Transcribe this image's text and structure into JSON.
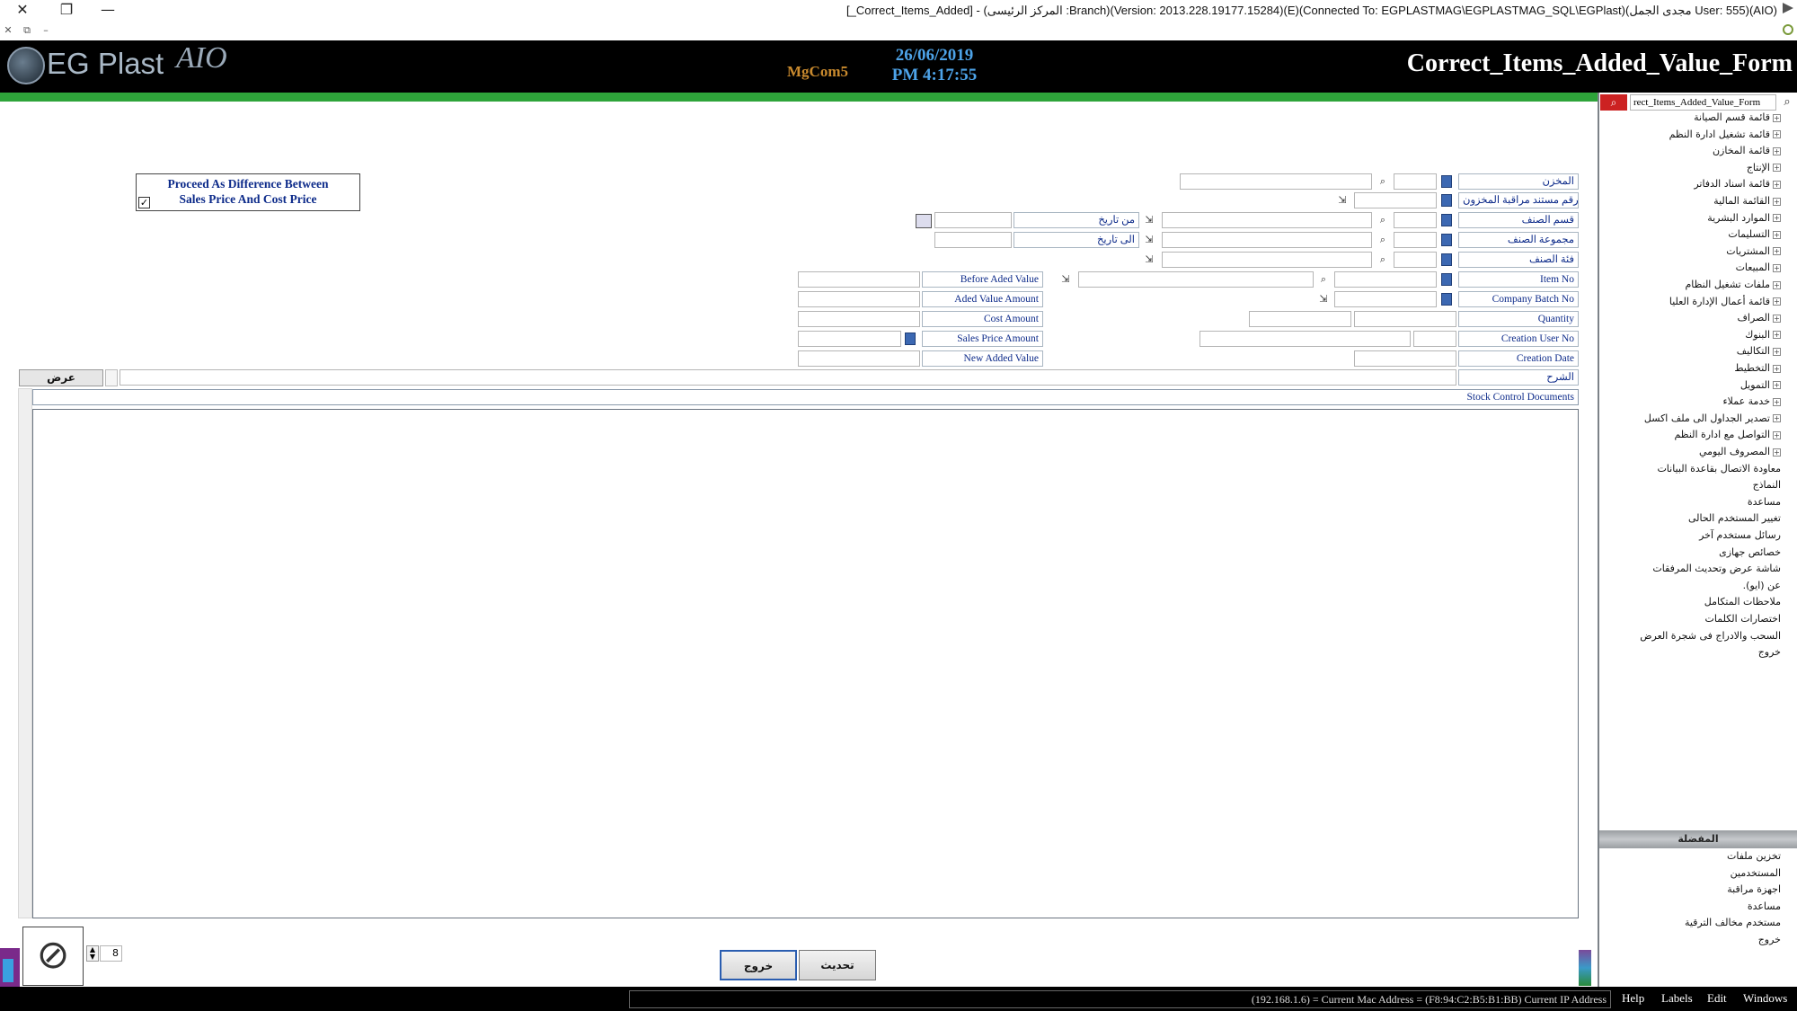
{
  "window": {
    "title": "[_Correct_Items_Added] - (المركز الرئيسى :Branch)(Version: 2013.228.19177.15284)(E)(Connected To: EGPLASTMAG\\EGPLASTMAG_SQL\\EGPlast)(مجدى الجمل User: 555)(AIO)",
    "close_glyph": "✕",
    "restore_glyph": "❐",
    "minimize_glyph": "—",
    "sub_close": "✕",
    "sub_restore": "⧉",
    "sub_min": "–"
  },
  "header": {
    "brand": "EG Plast",
    "brand_suffix": "AIO",
    "partner": "MgCom5",
    "date": "26/06/2019",
    "time": "PM 4:17:55",
    "form_title": "Correct_Items_Added_Value_Form"
  },
  "option": {
    "line1": "Proceed As Difference Between",
    "line2": "Sales Price And Cost Price",
    "checked_glyph": "✓"
  },
  "fields": {
    "store": "المخزن",
    "stock_doc_no": "رقم مستند مراقبة المخزون",
    "item_section": "قسم الصنف",
    "item_group": "مجموعة الصنف",
    "item_category": "فئة الصنف",
    "item_no": "Item No",
    "company_batch_no": "Company Batch No",
    "quantity": "Quantity",
    "creation_user_no": "Creation User No",
    "creation_date": "Creation Date",
    "description": "الشرح",
    "from_date": "من تاريخ",
    "to_date": "الى تاريخ",
    "before_added_value": "Before Aded Value",
    "added_value_amount": "Aded Value Amount",
    "cost_amount": "Cost Amount",
    "sales_price_amount": "Sales Price Amount",
    "new_added_value": "New Added Value"
  },
  "grid": {
    "view_button": "عرض",
    "title": "Stock Control Documents"
  },
  "buttons": {
    "exit": "خروج",
    "update": "تحديث"
  },
  "pager": {
    "value": "8"
  },
  "search": {
    "value": "rect_Items_Added_Value_Form"
  },
  "tree": [
    "قائمة قسم الصيانة",
    "قائمة تشغيل ادارة النظم",
    "قائمة المخازن",
    "الإنتاج",
    "قائمة اسناد الدفاتر",
    "القائمة المالية",
    "الموارد البشرية",
    "التسليمات",
    "المشتريات",
    "المبيعات",
    "ملفات تشغيل النظام",
    "قائمة أعمال الإدارة العليا",
    "الصراف",
    "البنوك",
    "التكاليف",
    "التخطيط",
    "التمويل",
    "خدمة عملاء",
    "تصدير الجداول الى ملف اكسل",
    "التواصل مع ادارة النظم",
    "المصروف اليومي",
    "معاودة الاتصال بقاعدة البيانات",
    "النماذج",
    "مساعدة",
    "تغيير المستخدم الحالى",
    "رسائل مستخدم آخر",
    "خصائص جهازى",
    "شاشة عرض وتحديث المرفقات",
    "عن (ايو).",
    "ملاحظات المتكامل",
    "اختصارات الكلمات",
    "السحب والادراج فى شجرة العرض",
    "خروج"
  ],
  "favorites": {
    "title": "المفضلة",
    "items": [
      "تخزين ملفات",
      "المستخدمين",
      "اجهزة مراقبة",
      "مساعدة",
      "مستخدم مخالف الترقية",
      "خروج"
    ]
  },
  "status": {
    "address": "(192.168.1.6) = Current Mac Address = (F8:94:C2:B5:B1:BB) Current IP Address",
    "menu": [
      "Help",
      "Labels",
      "Edit",
      "Windows"
    ]
  },
  "colors": {
    "accent": "#2ea43a",
    "label_text": "#0d2b8a",
    "header_bg": "#000000"
  }
}
